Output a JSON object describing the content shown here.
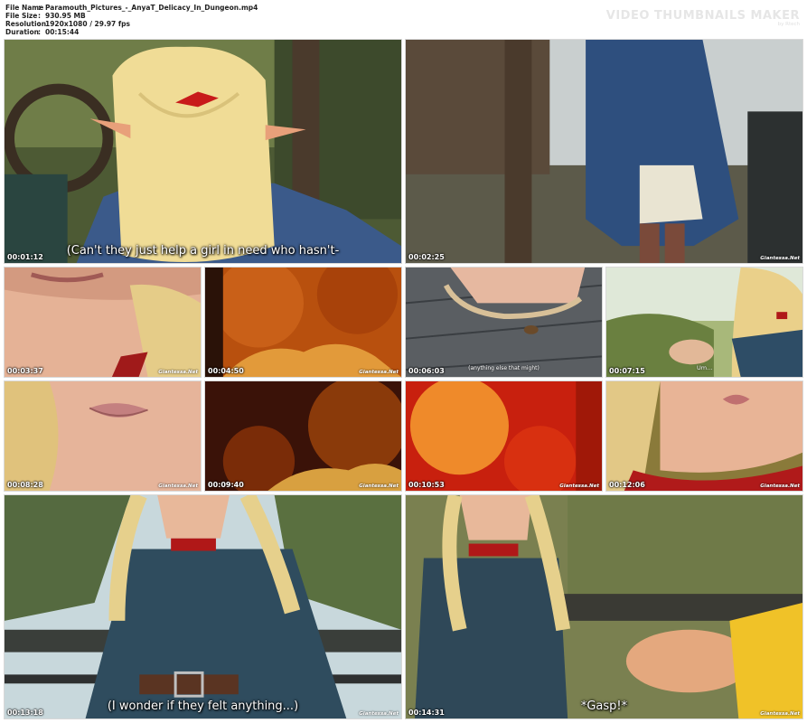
{
  "file_info": {
    "name_label": "File Name",
    "name_value": "Paramouth_Pictures_-_AnyaT_Delicacy_In_Dungeon.mp4",
    "size_label": "File Size",
    "size_value": "930.95 MB",
    "resolution_label": "Resolution",
    "resolution_value": "1920x1080 / 29.97 fps",
    "duration_label": "Duration",
    "duration_value": "00:15:44",
    "separator": ":"
  },
  "brand": {
    "title": "VIDEO THUMBNAILS MAKER",
    "subtitle": "by Rtech"
  },
  "watermark": "Giantessa.Net",
  "thumbnails": [
    {
      "time": "00:01:12",
      "subtitle": "(Can't they just help a girl in need who hasn't-"
    },
    {
      "time": "00:02:25",
      "subtitle": ""
    },
    {
      "time": "00:03:37",
      "subtitle": ""
    },
    {
      "time": "00:04:50",
      "subtitle": ""
    },
    {
      "time": "00:06:03",
      "subtitle": "(anything else that might)"
    },
    {
      "time": "00:07:15",
      "subtitle": "Um..."
    },
    {
      "time": "00:08:28",
      "subtitle": ""
    },
    {
      "time": "00:09:40",
      "subtitle": ""
    },
    {
      "time": "00:10:53",
      "subtitle": ""
    },
    {
      "time": "00:12:06",
      "subtitle": ""
    },
    {
      "time": "00:13:18",
      "subtitle": "(I wonder if they felt anything...)"
    },
    {
      "time": "00:14:31",
      "subtitle": "*Gasp!*"
    }
  ],
  "colors": {
    "background": "#ffffff",
    "brand_text": "#e6e6e6",
    "text": "#222222"
  }
}
